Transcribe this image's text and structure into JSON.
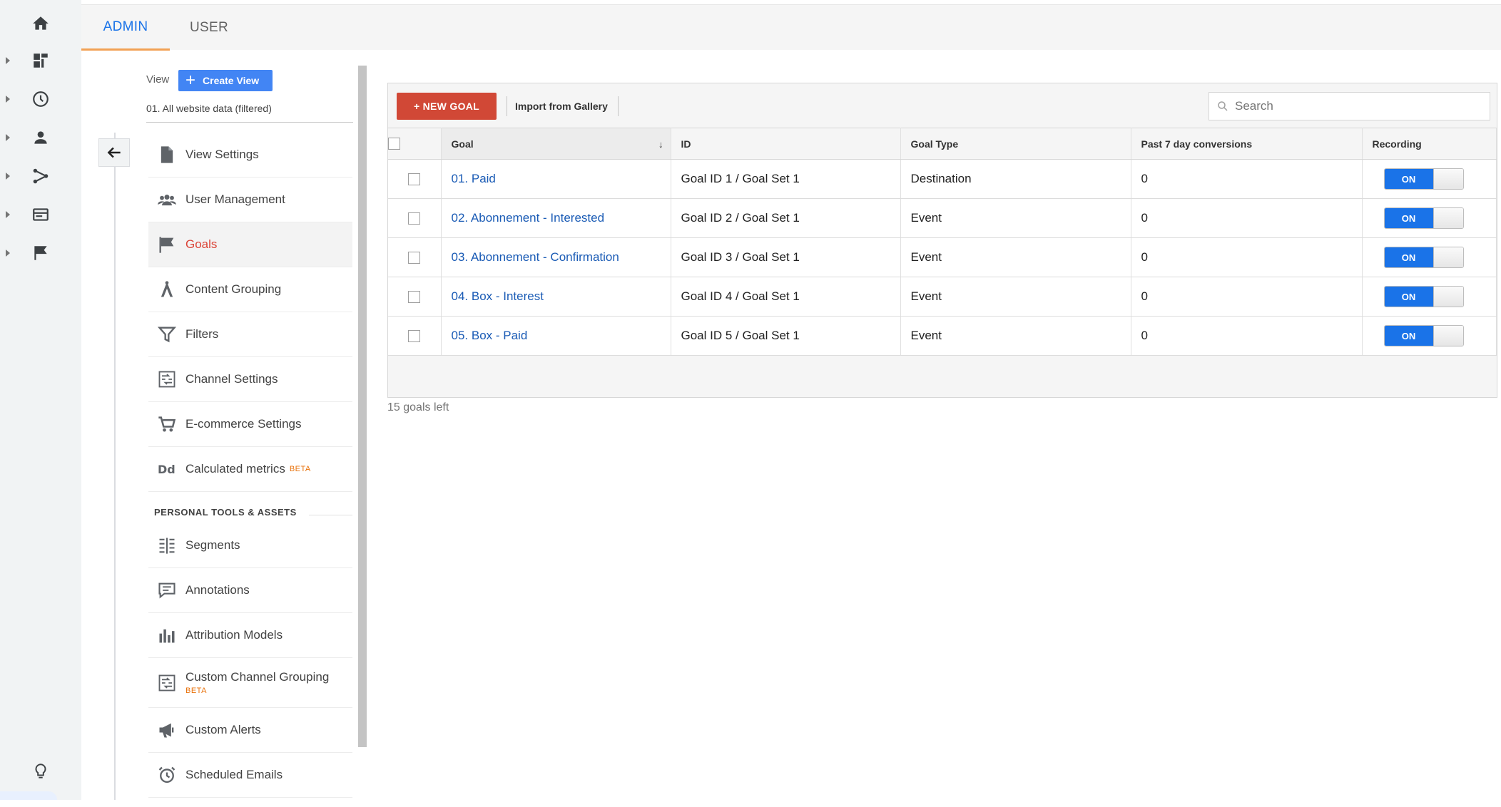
{
  "tabs": [
    {
      "label": "ADMIN",
      "active": true
    },
    {
      "label": "USER",
      "active": false
    }
  ],
  "rail": {
    "icons": [
      "home-icon",
      "dashboard-icon",
      "clock-icon",
      "person-icon",
      "acquisition-icon",
      "behavior-icon",
      "flag-icon",
      "lightbulb-icon"
    ]
  },
  "view": {
    "label": "View",
    "create_label": "Create View",
    "selected": "01. All website data (filtered)"
  },
  "menu": {
    "items": [
      {
        "label": "View Settings",
        "icon": "document-icon"
      },
      {
        "label": "User Management",
        "icon": "users-icon"
      },
      {
        "label": "Goals",
        "icon": "flag-icon",
        "active": true
      },
      {
        "label": "Content Grouping",
        "icon": "content-grouping-icon"
      },
      {
        "label": "Filters",
        "icon": "filter-icon"
      },
      {
        "label": "Channel Settings",
        "icon": "channel-settings-icon"
      },
      {
        "label": "E-commerce Settings",
        "icon": "cart-icon"
      },
      {
        "label": "Calculated metrics",
        "icon": "calculated-metrics-icon",
        "badge": "BETA"
      }
    ],
    "section_title": "PERSONAL TOOLS & ASSETS",
    "personal_items": [
      {
        "label": "Segments",
        "icon": "segments-icon"
      },
      {
        "label": "Annotations",
        "icon": "annotation-icon"
      },
      {
        "label": "Attribution Models",
        "icon": "attribution-icon"
      },
      {
        "label": "Custom Channel Grouping",
        "icon": "custom-channel-icon",
        "badge": "BETA"
      },
      {
        "label": "Custom Alerts",
        "icon": "megaphone-icon"
      },
      {
        "label": "Scheduled Emails",
        "icon": "alarm-clock-icon"
      }
    ]
  },
  "toolbar": {
    "new_goal_label": "+ NEW GOAL",
    "import_label": "Import from Gallery",
    "search_placeholder": "Search"
  },
  "table": {
    "headers": {
      "goal": "Goal",
      "id": "ID",
      "type": "Goal Type",
      "conversions": "Past 7 day conversions",
      "recording": "Recording"
    },
    "sort_indicator": "↓",
    "rows": [
      {
        "goal": "01. Paid",
        "id": "Goal ID 1 / Goal Set 1",
        "type": "Destination",
        "conversions": "0",
        "recording": "ON"
      },
      {
        "goal": "02. Abonnement - Interested",
        "id": "Goal ID 2 / Goal Set 1",
        "type": "Event",
        "conversions": "0",
        "recording": "ON"
      },
      {
        "goal": "03. Abonnement - Confirmation",
        "id": "Goal ID 3 / Goal Set 1",
        "type": "Event",
        "conversions": "0",
        "recording": "ON"
      },
      {
        "goal": "04. Box - Interest",
        "id": "Goal ID 4 / Goal Set 1",
        "type": "Event",
        "conversions": "0",
        "recording": "ON"
      },
      {
        "goal": "05. Box - Paid",
        "id": "Goal ID 5 / Goal Set 1",
        "type": "Event",
        "conversions": "0",
        "recording": "ON"
      }
    ]
  },
  "footer": {
    "goals_left": "15 goals left"
  },
  "colors": {
    "accent_blue": "#1a73e8",
    "new_goal_red": "#d14836",
    "active_menu_red": "#db4437",
    "tab_underline": "#f2a154"
  }
}
